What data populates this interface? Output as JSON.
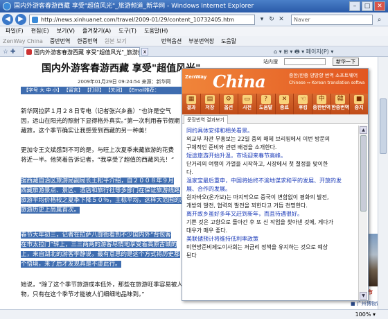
{
  "window": {
    "title": "国内外游客春游西藏 享受\"超值风光\"_旅游频道_新华网 - Windows Internet Explorer",
    "min": "–",
    "max": "□",
    "close": "✕"
  },
  "address": {
    "url": "http://news.xinhuanet.com/travel/2009-01/29/content_10732405.htm",
    "search_placeholder": "Naver"
  },
  "menu": [
    "파일(F)",
    "편집(E)",
    "보기(V)",
    "즐겨찾기(A)",
    "도구(T)",
    "도움말(H)"
  ],
  "toolbar2": {
    "items": [
      "ZenWay China",
      "중반번역",
      "한중번역",
      "원본 보기",
      "번역옵션",
      "부분번역창",
      "도움말"
    ],
    "dim_index": [
      0,
      3
    ]
  },
  "tab": {
    "label": "国内外游客春游西藏 享受\"超值风光\"_旅游频道...",
    "close": "x"
  },
  "page_tools": "⌂ ▾ ⊞ ▾ 🖶 ▾ 페이지(P) ▾",
  "article": {
    "headline": "国内外游客春游西藏 享受\"超值风光\"",
    "dateline": "2009年01月29日 09:24:54    来源：新华网",
    "toolbar_text": "【字号 大 中 小】  【留言】  【打印】  【关闭】  【Email推荐：",
    "p1": [
      "新华网拉萨１月２８日专电（记者张兴乡鑫）“也许是空气",
      "因，远山在阳光的照射下显得格外真实。”第一次利用春节假期",
      "藏旅，这个季节确实让我感受到西藏的另一种美！"
    ],
    "p2": [
      "更加令王文斌感到不可的是，与旺上次夏季来藏旅游的花费",
      "将近一半。他笑着告诉记者，“我享受了超值的西藏风光！”"
    ],
    "p3": [
      "据西藏自治区旅游局副局长王松平介绍，自２００８年９月",
      "西藏旅游景点、景区、酒店和旅行社等多部门在保证旅游线路",
      "旅游平均价格较之夏季下降５０％，主标平均，这样大范围的旅",
      "旅游历史上尚属首次。"
    ],
    "p4": [
      "春节大年初三，记者在拉萨八廓街看到不少国内外“背包客",
      "在市太拉门”转上，三三两两的游客尽情地享受着高原古城的",
      "上，来自湖北的游客李静说，最有意思的是这个方式将历史都",
      "个悟境，来了后才发现真是不虚此行。"
    ],
    "p5": [
      "她说，“除了这个季节旅游成本低外，那些在旅游旺季容易被人们忽略的事",
      "物，只有在这个季节才能被人们细细地品味到。”"
    ]
  },
  "right_column": {
    "search_label": "站内搜",
    "search_button": "新华一下",
    "tourism": "旅游超市",
    "link": "■ 广州博物馆公公 \"长沙\"..."
  },
  "translator": {
    "logo_sub": "ZenWay",
    "logo": "China",
    "brand": "중한/한중 양방향 번역 소프트웨어",
    "brand2": "Chinese ↔ Korean translation software ZenWay China",
    "tools": [
      {
        "icon": "▦",
        "label": "결과"
      },
      {
        "icon": "▤",
        "label": "저장"
      },
      {
        "icon": "⚙",
        "label": "옵션"
      },
      {
        "icon": "▭",
        "label": "사전"
      },
      {
        "icon": "?",
        "label": "도움말"
      },
      {
        "icon": "✕",
        "label": "종료"
      },
      {
        "icon": "☜",
        "label": "후킹"
      },
      {
        "icon": "中",
        "label": "중한번역"
      },
      {
        "icon": "韓",
        "label": "한중번역"
      },
      {
        "icon": "■",
        "label": "중지"
      }
    ],
    "tab": "문장번역 결과보기",
    "lines": [
      {
        "lang": "zh",
        "text": "同约具体安排和相关看景。"
      },
      {
        "lang": "ko",
        "text": "외교부 차관 무홍보는 22일 중외 매체 브리핑에서 이번 방문의"
      },
      {
        "lang": "ko",
        "text": "구체적인 준비와 관련 배경을 소개한다."
      },
      {
        "lang": "zh",
        "text": "短途旅游开始升温，市场迎来春节高峰。"
      },
      {
        "lang": "ko",
        "text": "단거리의 여행이 가열을 시작하고, 시장에서 첫 절정을 맞이한"
      },
      {
        "lang": "ko",
        "text": "다."
      },
      {
        "lang": "zh",
        "text": "温家宝最后重申，中国将始终不渝地谋求和平的发展、开放的发"
      },
      {
        "lang": "zh",
        "text": "展、合作的发展。"
      },
      {
        "lang": "ko",
        "text": "원자바오(온가보)는 마지막으로 중국이 변함없이 평화의 발전,"
      },
      {
        "lang": "ko",
        "text": "개방의 발전, 협력의 발전을 꾀한다고 거듭 천명한다."
      },
      {
        "lang": "zh",
        "text": "离开故乡虽好多年又赶到新年，而且待遇很好。"
      },
      {
        "lang": "ko",
        "text": "기쁜 것은 고향으로 돌아간 후 또 신 작업을 찾아낸 것에, 게다가"
      },
      {
        "lang": "ko",
        "text": "대우가 매우 좋다."
      },
      {
        "lang": "zh",
        "text": "美联储预计将维持低利率政策"
      },
      {
        "lang": "ko",
        "text": "미연방준비제도이사회는 저금리 정책을 유지하는 것으로 예상"
      },
      {
        "lang": "ko",
        "text": "된다"
      }
    ]
  },
  "status": {
    "left": "",
    "zoom": "100% ▾"
  }
}
